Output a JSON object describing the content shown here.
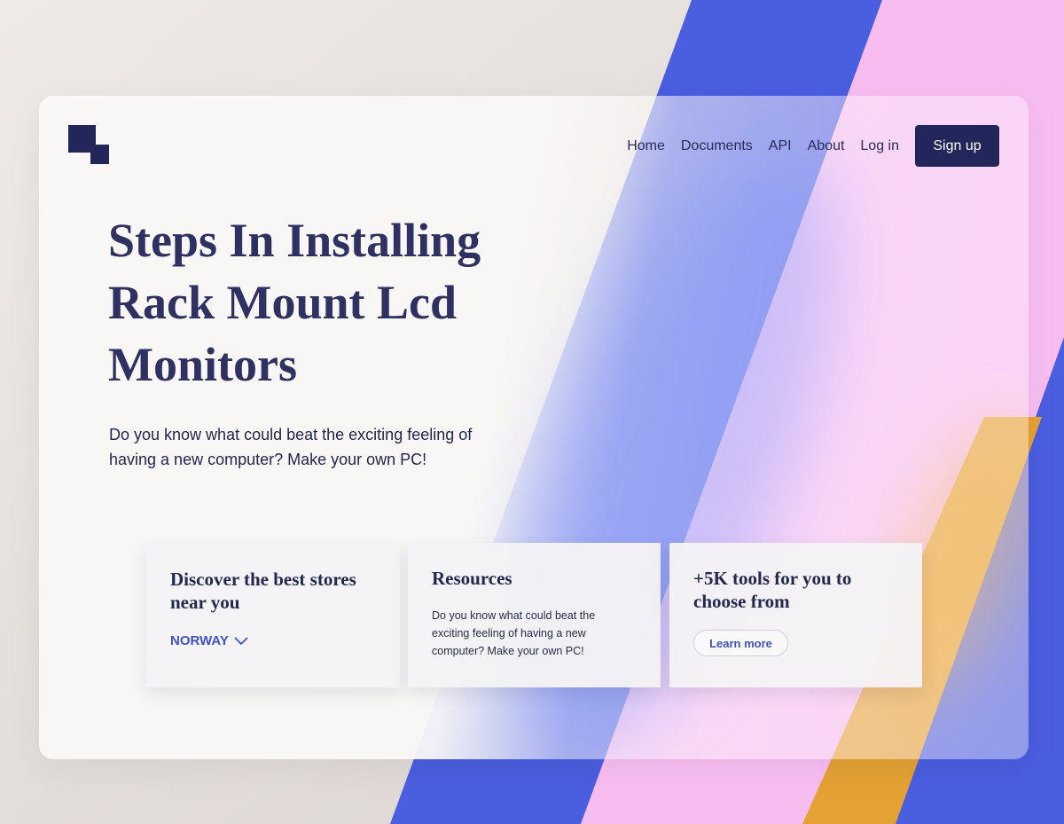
{
  "nav": {
    "items": [
      {
        "label": "Home"
      },
      {
        "label": "Documents"
      },
      {
        "label": "API"
      },
      {
        "label": "About"
      },
      {
        "label": "Log in"
      }
    ],
    "signup_label": "Sign up"
  },
  "hero": {
    "title": "Steps In Installing Rack Mount Lcd Monitors",
    "text": "Do you know what could beat the exciting feeling of having a new computer? Make your own PC!"
  },
  "cards": {
    "stores": {
      "title": "Discover the best stores near you",
      "country": "NORWAY",
      "icon": "chevron-down-icon"
    },
    "resources": {
      "title": "Resources",
      "text": "Do you know what could beat the exciting feeling of having a new computer? Make your own PC!"
    },
    "tools": {
      "title": "+5K tools for you to choose from",
      "button_label": "Learn more"
    }
  },
  "colors": {
    "primary": "#22265b",
    "accent": "#3f53c7",
    "stripe_blue": "#4a5ee0",
    "stripe_pink": "#f6bdf0",
    "stripe_orange": "#e4a134"
  }
}
